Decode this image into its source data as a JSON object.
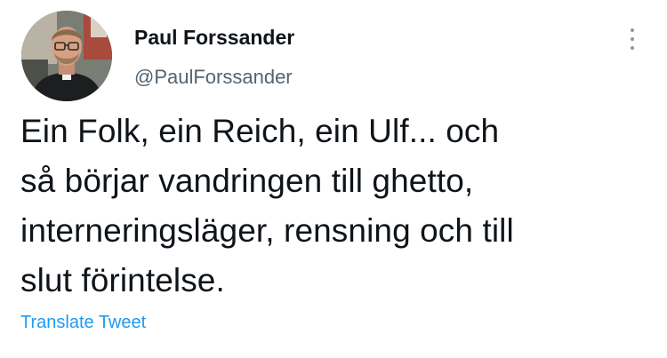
{
  "tweet": {
    "author": {
      "display_name": "Paul Forssander",
      "handle": "@PaulForssander",
      "avatar_icon": "profile-photo"
    },
    "more_icon": "more-vertical-icon",
    "text_lines": [
      "Ein Folk, ein Reich, ein Ulf... och",
      "så börjar vandringen till ghetto,",
      "interneringsläger, rensning och till",
      "slut förintelse."
    ],
    "translate_label": "Translate Tweet"
  },
  "colors": {
    "text_primary": "#0f1419",
    "text_secondary": "#536471",
    "link": "#1d9bf0",
    "more_dots": "#8b98a5"
  }
}
